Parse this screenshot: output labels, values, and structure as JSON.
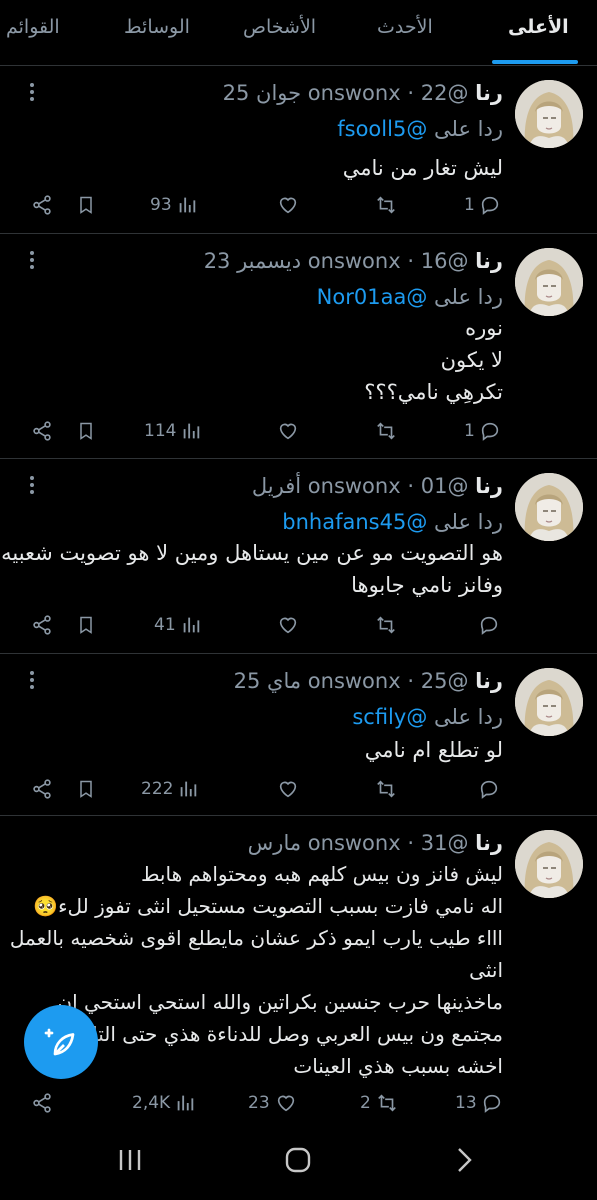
{
  "tabs": [
    {
      "label": "الأعلى",
      "active": true
    },
    {
      "label": "الأحدث",
      "active": false
    },
    {
      "label": "الأشخاص",
      "active": false
    },
    {
      "label": "الوسائط",
      "active": false
    },
    {
      "label": "القوائم",
      "active": false
    }
  ],
  "reply_word": "ردا على",
  "tweets": [
    {
      "name": "رنا",
      "handle": "@onswonx",
      "separator": "·",
      "date": "22 جوان 25",
      "reply_to": "@fsooll5",
      "lines": [
        "ليش تغار من نامي"
      ],
      "stats": {
        "replies": "1",
        "retweets": "",
        "likes": "",
        "views": "93"
      }
    },
    {
      "name": "رنا",
      "handle": "@onswonx",
      "separator": "·",
      "date": "16 ديسمبر 23",
      "reply_to": "@Nor01aa",
      "lines": [
        "نوره",
        "لا يكون",
        "تكرهِي نامي؟؟؟"
      ],
      "stats": {
        "replies": "1",
        "retweets": "",
        "likes": "",
        "views": "114"
      }
    },
    {
      "name": "رنا",
      "handle": "@onswonx",
      "separator": "·",
      "date": "01 أفريل",
      "reply_to": "@bnhafans45",
      "lines": [
        "هو التصويت مو عن مين يستاهل ومين لا هو تصويت شعبيه",
        "وفانز نامي جابوها"
      ],
      "stats": {
        "replies": "",
        "retweets": "",
        "likes": "",
        "views": "41"
      }
    },
    {
      "name": "رنا",
      "handle": "@onswonx",
      "separator": "·",
      "date": "25 ماي 25",
      "reply_to": "@scfily",
      "lines": [
        "لو تطلع ام نامي"
      ],
      "stats": {
        "replies": "",
        "retweets": "",
        "likes": "",
        "views": "222"
      }
    },
    {
      "name": "رنا",
      "handle": "@onswonx",
      "separator": "·",
      "date": "31 مارس",
      "reply_to": "",
      "lines": [
        "ليش فانز ون بيس كلهم هبه ومحتواهم هابط",
        "اله نامي فازت بسبب التصويت مستحيل انثى تفوز للء🥺",
        "اااء طيب يارب ايمو ذكر عشان مايطلع اقوى شخصيه بالعمل",
        "انثى",
        "ماخذينها حرب جنسين بكراتين والله استحي استحي ان",
        "مجتمع ون بيس العربي وصل للدناءة هذي حتى التا",
        "اخشه بسبب هذي العينات"
      ],
      "stats": {
        "replies": "13",
        "retweets": "2",
        "likes": "23",
        "views": "2,4K"
      }
    }
  ],
  "colors": {
    "accent": "#1d9bf0",
    "muted": "#8b98a5",
    "text": "#e7e9ea",
    "divider": "#2f3336"
  },
  "icons": [
    "more-vertical-icon",
    "reply-icon",
    "retweet-icon",
    "like-icon",
    "views-icon",
    "bookmark-icon",
    "share-icon",
    "compose-icon",
    "recents-icon",
    "home-icon",
    "back-icon"
  ]
}
